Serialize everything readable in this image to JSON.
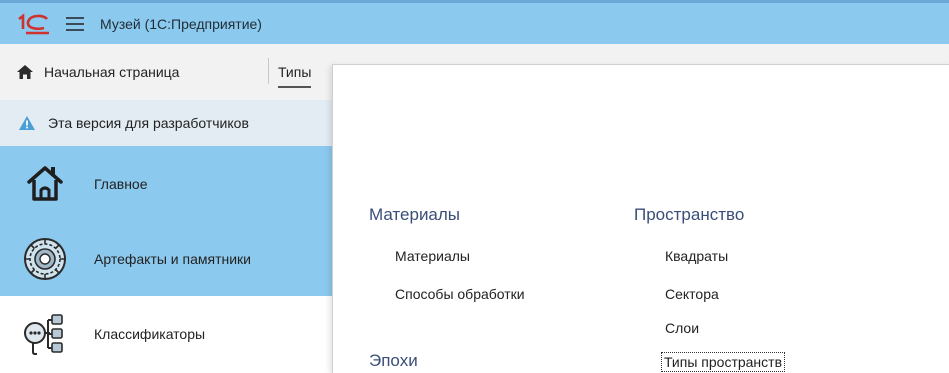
{
  "window": {
    "app_title": "Музей  (1С:Предприятие)"
  },
  "tabs": {
    "home_label": "Начальная страница",
    "types_label": "Типы"
  },
  "banner": {
    "text": "Эта версия для разработчиков"
  },
  "sidebar": {
    "items": [
      {
        "label": "Главное",
        "icon": "house-icon",
        "active": true
      },
      {
        "label": "Артефакты и памятники",
        "icon": "medallion-icon",
        "active": true
      },
      {
        "label": "Классификаторы",
        "icon": "classifier-tree-icon",
        "active": false
      }
    ]
  },
  "panel": {
    "materials": {
      "title": "Материалы",
      "links": [
        "Материалы",
        "Способы обработки"
      ]
    },
    "epochs": {
      "title": "Эпохи"
    },
    "space": {
      "title": "Пространство",
      "links": [
        "Квадраты",
        "Сектора",
        "Слои",
        "Типы пространств"
      ]
    }
  },
  "colors": {
    "titlebar": "#8cc9ee",
    "active_section": "#8cc9ee",
    "banner": "#e3ecf3",
    "section_title": "#3a4e77",
    "logo_red": "#d0312d"
  }
}
